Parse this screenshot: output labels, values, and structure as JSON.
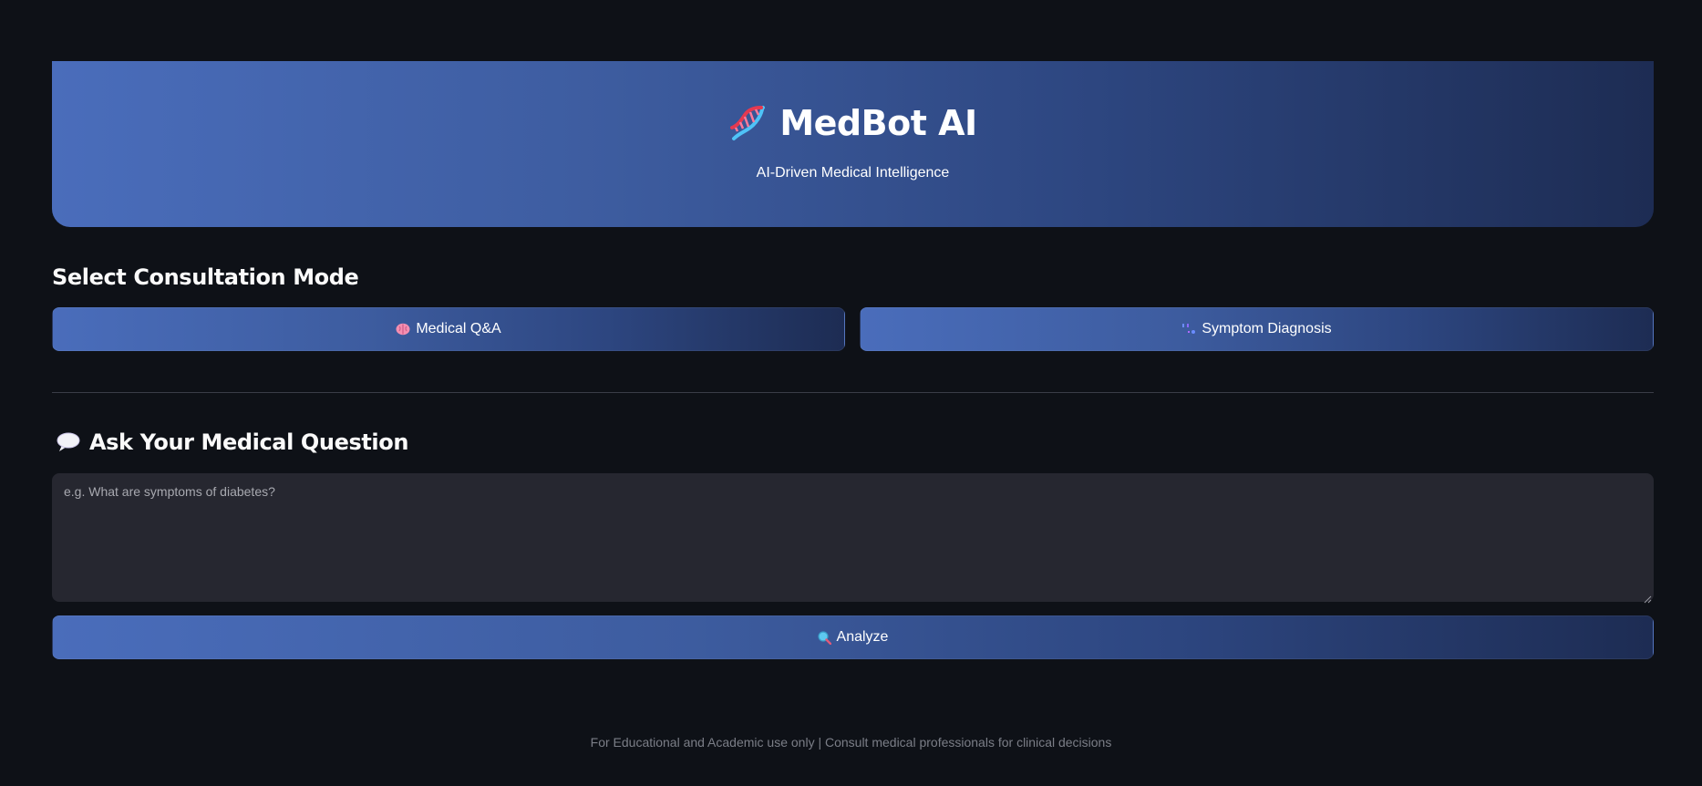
{
  "header": {
    "title": "MedBot AI",
    "subtitle": "AI-Driven Medical Intelligence",
    "icon": "dna-icon"
  },
  "mode_section": {
    "heading": "Select Consultation Mode",
    "buttons": [
      {
        "label": "Medical Q&A",
        "icon": "brain-icon"
      },
      {
        "label": "Symptom Diagnosis",
        "icon": "dots-icon"
      }
    ]
  },
  "question_section": {
    "heading": "Ask Your Medical Question",
    "icon": "speech-bubble-icon",
    "input": {
      "value": "",
      "placeholder": "e.g. What are symptoms of diabetes?"
    },
    "analyze_button": {
      "label": "Analyze",
      "icon": "magnifier-icon"
    }
  },
  "footer": {
    "text": "For Educational and Academic use only | Consult medical professionals for clinical decisions"
  },
  "colors": {
    "background": "#0e1117",
    "gradient_start": "#4a6dbb",
    "gradient_end": "#1d2c53",
    "input_background": "#262730"
  }
}
